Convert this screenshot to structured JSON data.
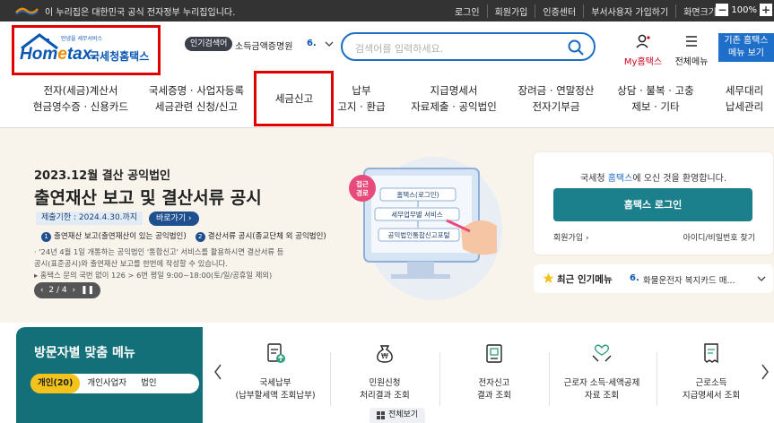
{
  "govbar": {
    "notice": "이 누리집은 대한민국 공식 전자정부 누리집입니다.",
    "links": [
      "로그인",
      "회원가입",
      "인증센터",
      "부서사용자 가입하기",
      "화면크기"
    ],
    "zoom_minus": "−",
    "zoom_value": "100%",
    "zoom_plus": "+"
  },
  "header": {
    "logo_small": "안녕을 세무서비스",
    "logo_name_a": "Hom",
    "logo_name_b": "e",
    "logo_name_c": "tax.",
    "logo_korean": "국세청홈택스",
    "popular_label": "인기검색어",
    "popular_word": "소득금액증명원",
    "popular_rank": "6.",
    "search_placeholder": "검색어를 입력하세요.",
    "my_home": "My홈택스",
    "all_menu": "전체메뉴",
    "basic_line1": "기존 홈택스",
    "basic_line2": "메뉴 보기"
  },
  "nav": [
    {
      "line1": "전자(세금)계산서",
      "line2": "현금영수증 · 신용카드"
    },
    {
      "line1": "국세증명 · 사업자등록",
      "line2": "세금관련 신청/신고"
    },
    {
      "line1": "세금신고",
      "line2": ""
    },
    {
      "line1": "납부",
      "line2": "고지 · 환급"
    },
    {
      "line1": "지급명세서",
      "line2": "자료제출 · 공익법인"
    },
    {
      "line1": "장려금 · 연말정산",
      "line2": "전자기부금"
    },
    {
      "line1": "상담 · 불복 · 고충",
      "line2": "제보 · 기타"
    },
    {
      "line1": "세무대리",
      "line2": "납세관리"
    }
  ],
  "hero": {
    "subtitle": "2023.12월 결산 공익법인",
    "title": "출연재산 보고 및 결산서류 공시",
    "deadline": "제출기한 : 2024.4.30.까지",
    "goto": "바로가기 ›",
    "item1_num": "1",
    "item1": "출연재산 보고(출연재산이 있는 공익법인)",
    "item2_num": "2",
    "item2": "결산서류 공시(종교단체 외 공익법인)",
    "bullet1": "· '24년 4월 1일 개통하는 공익법인 '통합신고' 서비스를 활용하시면 결산서류 등",
    "bullet2": "  공시(표준공시)와 출연재산 보고를 한번에 작성할 수 있습니다.",
    "bullet3": "▸ 홈택스 문의 국번 없이 126 > 6번 평일 9:00~18:00(토/일/공휴일 제외)",
    "pager_prev": "‹",
    "pager": "2 / 4",
    "pager_next": "›",
    "pager_pause": "❚❚",
    "illu_badge1": "접근",
    "illu_badge2": "경로",
    "illu_step1": "홈택스(로그인)",
    "illu_step2": "세무업무별 서비스",
    "illu_step3": "공익법인통합신고포털"
  },
  "login": {
    "welcome_pre": "국세청 ",
    "welcome_brand": "홈택스",
    "welcome_post": "에 오신 것을 환영합니다.",
    "button": "홈택스 로그인",
    "join": "회원가입 ›",
    "find": "아이디/비밀번호 찾기"
  },
  "popular_menu": {
    "title": "최근 인기메뉴",
    "rank": "6.",
    "text": "화물운전자 복지카드 매..."
  },
  "visitor": {
    "title": "방문자별 맞춤 메뉴",
    "tabs": [
      "개인(20)",
      "개인사업자",
      "법인"
    ]
  },
  "services": [
    {
      "icon": "document-upload-icon",
      "line1": "국세납부",
      "line2": "(납부할세액 조회납부)"
    },
    {
      "icon": "money-bag-icon",
      "line1": "민원신청",
      "line2": "처리결과 조회"
    },
    {
      "icon": "report-doc-icon",
      "line1": "전자신고",
      "line2": "결과 조회"
    },
    {
      "icon": "handshake-icon",
      "line1": "근로자 소득·세액공제",
      "line2": "자료 조회"
    },
    {
      "icon": "receipt-icon",
      "line1": "근로소득",
      "line2": "지급명세서 조회"
    }
  ],
  "all_view": "전체보기",
  "colors": {
    "brand_blue": "#0a57b3",
    "teal": "#1b7f8c",
    "highlight_red": "#e00000",
    "hero_bg": "#f8f4ec",
    "tab_yellow": "#f3c31b"
  }
}
